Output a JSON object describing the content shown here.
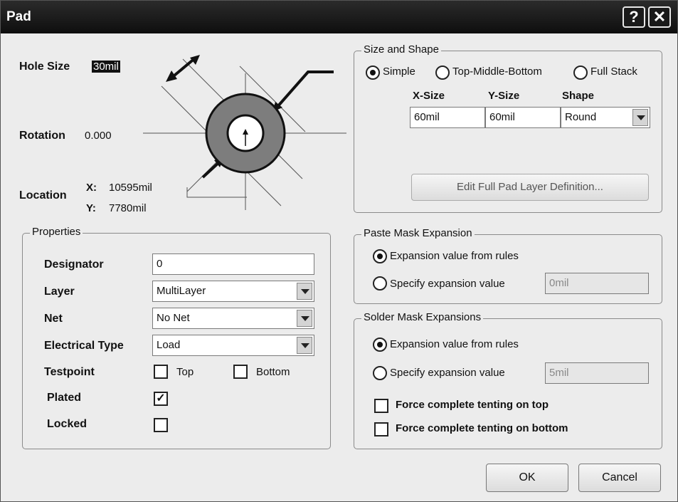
{
  "window": {
    "title": "Pad",
    "help_label": "?",
    "close_label": "✕"
  },
  "top": {
    "hole_size_label": "Hole Size",
    "hole_size_value": "30mil",
    "rotation_label": "Rotation",
    "rotation_value": "0.000",
    "location_label": "Location",
    "x_label": "X:",
    "x_value": "10595mil",
    "y_label": "Y:",
    "y_value": "7780mil"
  },
  "size_shape": {
    "title": "Size and Shape",
    "modes": [
      "Simple",
      "Top-Middle-Bottom",
      "Full Stack"
    ],
    "selected_mode": "Simple",
    "col_x": "X-Size",
    "col_y": "Y-Size",
    "col_shape": "Shape",
    "x_size": "60mil",
    "y_size": "60mil",
    "shape": "Round",
    "edit_button": "Edit Full Pad Layer Definition..."
  },
  "properties": {
    "title": "Properties",
    "designator_label": "Designator",
    "designator_value": "0",
    "layer_label": "Layer",
    "layer_value": "MultiLayer",
    "net_label": "Net",
    "net_value": "No Net",
    "etype_label": "Electrical Type",
    "etype_value": "Load",
    "testpoint_label": "Testpoint",
    "testpoint_top": "Top",
    "testpoint_bottom": "Bottom",
    "plated_label": "Plated",
    "plated_checked": true,
    "locked_label": "Locked",
    "locked_checked": false
  },
  "paste_mask": {
    "title": "Paste Mask Expansion",
    "opt_rules": "Expansion value from rules",
    "opt_specify": "Specify expansion value",
    "value": "0mil"
  },
  "solder_mask": {
    "title": "Solder Mask Expansions",
    "opt_rules": "Expansion value from rules",
    "opt_specify": "Specify expansion value",
    "value": "5mil",
    "tent_top": "Force complete tenting on top",
    "tent_bottom": "Force complete tenting on bottom"
  },
  "buttons": {
    "ok": "OK",
    "cancel": "Cancel"
  },
  "colors": {
    "pad_ring": "#7d7d7d",
    "titlebar": "#111111",
    "dialog_bg": "#ececec"
  },
  "icons": {
    "help": "help-icon",
    "close": "close-icon",
    "check": "checkmark-icon"
  }
}
